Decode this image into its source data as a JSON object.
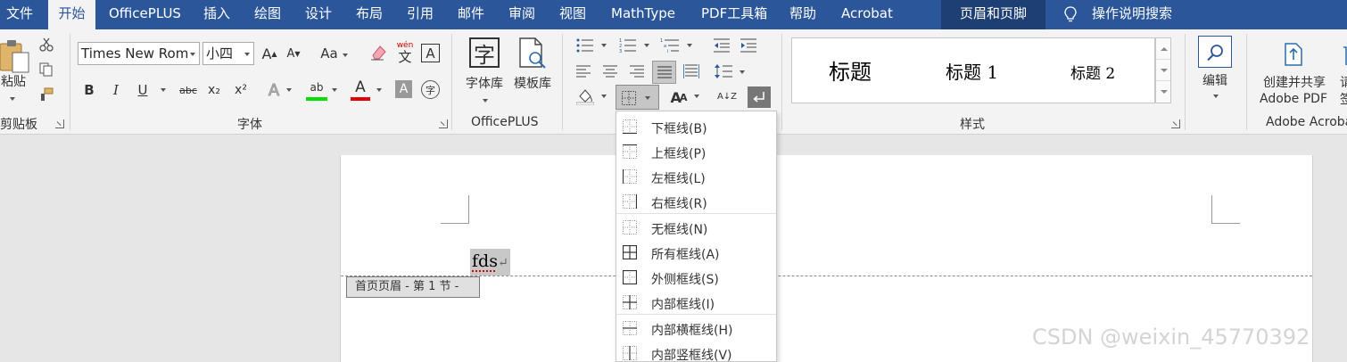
{
  "tabs": [
    {
      "label": "文件"
    },
    {
      "label": "开始"
    },
    {
      "label": "OfficePLUS"
    },
    {
      "label": "插入"
    },
    {
      "label": "绘图"
    },
    {
      "label": "设计"
    },
    {
      "label": "布局"
    },
    {
      "label": "引用"
    },
    {
      "label": "邮件"
    },
    {
      "label": "审阅"
    },
    {
      "label": "视图"
    },
    {
      "label": "MathType"
    },
    {
      "label": "PDF工具箱"
    },
    {
      "label": "帮助"
    },
    {
      "label": "Acrobat"
    },
    {
      "label": "页眉和页脚"
    }
  ],
  "search": {
    "label": "操作说明搜索"
  },
  "ribbon": {
    "clipboard": {
      "paste": "粘贴",
      "group": "剪贴板"
    },
    "font": {
      "name": "Times New Rom",
      "size": "小四",
      "group": "字体",
      "aa": "Aa",
      "wen": "wén",
      "wen_char": "文",
      "a_box": "A",
      "bold": "B",
      "italic": "I",
      "underline": "U",
      "strike": "abc",
      "sub": "x₂",
      "sup": "x²",
      "effects": "A",
      "highlight": "ab",
      "fontcolor": "A",
      "shade": "A",
      "enclose": "字"
    },
    "officeplus": {
      "font_lib": "字体库",
      "template_lib": "模板库",
      "group": "OfficePLUS",
      "zi": "字"
    },
    "paragraph": {
      "sort": "A↓Z"
    },
    "styles": {
      "items": [
        "标题",
        "标题 1",
        "标题 2"
      ],
      "group": "样式"
    },
    "editing": {
      "label": "编辑"
    },
    "adobe": {
      "create_line1": "创建并共享",
      "create_line2": "Adobe PDF",
      "group": "Adobe Acrobat",
      "partial1": "请",
      "partial2": "签"
    }
  },
  "document": {
    "text": "fds",
    "para_mark": "↵",
    "header_tag": "首页页眉 - 第 1 节 -",
    "watermark": "CSDN @weixin_45770392"
  },
  "border_menu": {
    "items": [
      {
        "label": "下框线(B)"
      },
      {
        "label": "上框线(P)"
      },
      {
        "label": "左框线(L)"
      },
      {
        "label": "右框线(R)"
      },
      {
        "label": "无框线(N)"
      },
      {
        "label": "所有框线(A)"
      },
      {
        "label": "外侧框线(S)"
      },
      {
        "label": "内部框线(I)"
      },
      {
        "label": "内部横框线(H)"
      },
      {
        "label": "内部竖框线(V)"
      }
    ]
  },
  "colors": {
    "title_bar": "#2b579a",
    "ribbon": "#f3f3f3",
    "highlight": "#00e000",
    "font_color": "#e00000"
  }
}
